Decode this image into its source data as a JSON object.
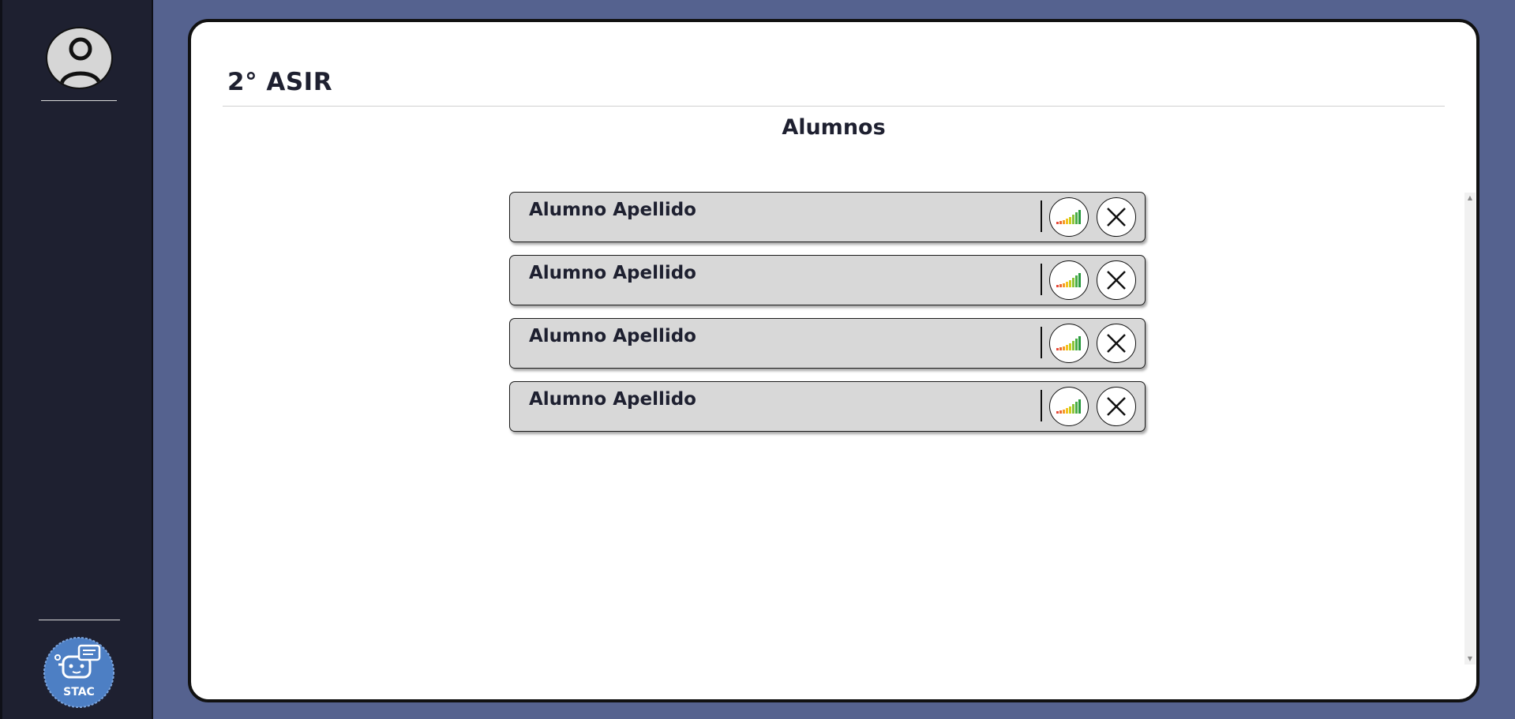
{
  "sidebar": {
    "avatar_icon": "user-avatar-icon",
    "logo_text": "STAC",
    "logo_color": "#4d7fc4"
  },
  "header": {
    "class_title": "2° ASIR"
  },
  "main": {
    "section_title": "Alumnos",
    "students": [
      {
        "name": "Alumno Apellido",
        "stats_icon": "signal-bars-icon",
        "remove_icon": "close-icon"
      },
      {
        "name": "Alumno Apellido",
        "stats_icon": "signal-bars-icon",
        "remove_icon": "close-icon"
      },
      {
        "name": "Alumno Apellido",
        "stats_icon": "signal-bars-icon",
        "remove_icon": "close-icon"
      },
      {
        "name": "Alumno Apellido",
        "stats_icon": "signal-bars-icon",
        "remove_icon": "close-icon"
      }
    ]
  },
  "colors": {
    "background": "#55628f",
    "sidebar": "#1e2030",
    "panel": "#ffffff",
    "row": "#d8d8d8",
    "text": "#1e2030"
  }
}
